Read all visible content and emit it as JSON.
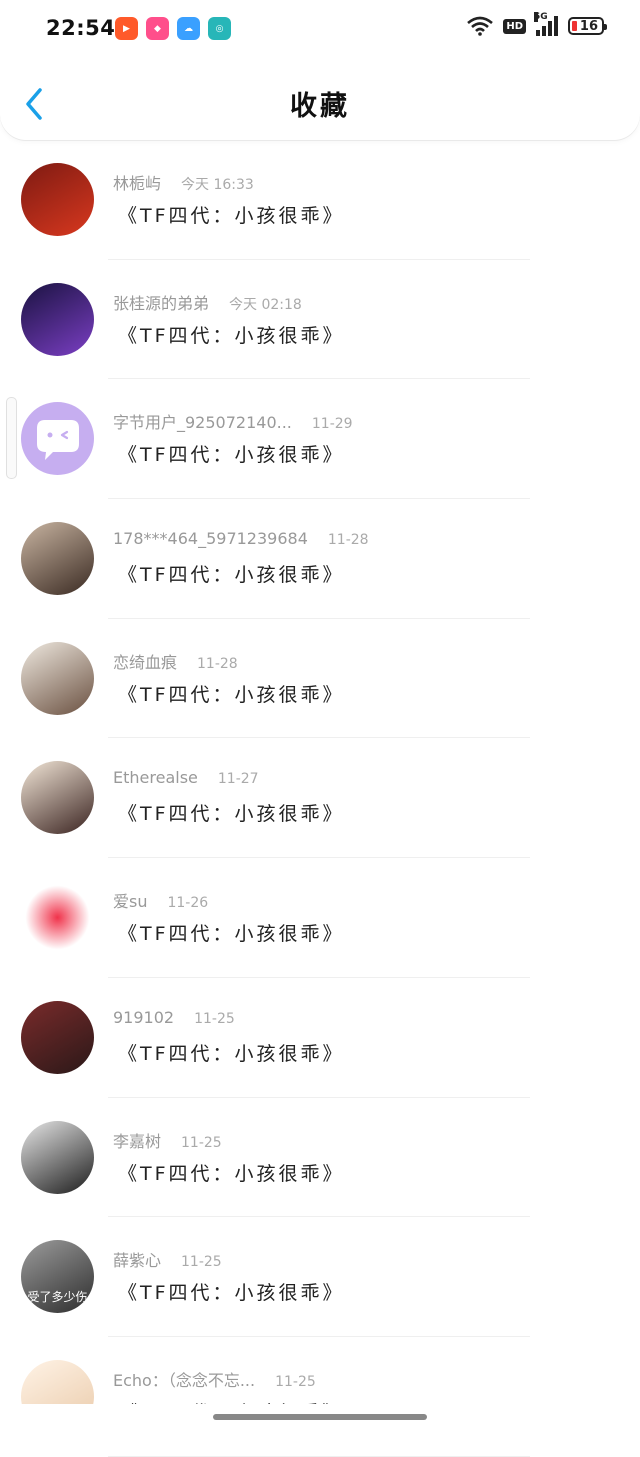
{
  "status_bar": {
    "time": "22:54",
    "hd": "HD",
    "network": "5G",
    "battery": "16",
    "app_icons": [
      "video-app-icon",
      "shop-app-icon",
      "weather-app-icon",
      "network-app-icon"
    ]
  },
  "nav": {
    "title": "收藏"
  },
  "items": [
    {
      "name": "林栀屿",
      "time": "今天 16:33",
      "content": "《TF四代：小孩很乖》",
      "avatar_colors": [
        "#7d1a12",
        "#d8381f"
      ]
    },
    {
      "name": "张桂源的弟弟",
      "time": "今天 02:18",
      "content": "《TF四代：小孩很乖》",
      "avatar_colors": [
        "#1a1240",
        "#7b3fc4"
      ]
    },
    {
      "name": "字节用户_925072140...",
      "time": "11-29",
      "content": "《TF四代：小孩很乖》",
      "avatar_colors": [
        "#d7c4f6",
        "#c6aef0"
      ]
    },
    {
      "name": "178***464_5971239684",
      "time": "11-28",
      "content": "《TF四代：小孩很乖》",
      "avatar_colors": [
        "#c9b5a2",
        "#3a2a22"
      ]
    },
    {
      "name": "恋绮血痕",
      "time": "11-28",
      "content": "《TF四代：小孩很乖》",
      "avatar_colors": [
        "#efe9e0",
        "#6a5040"
      ]
    },
    {
      "name": "Etherealse",
      "time": "11-27",
      "content": "《TF四代：小孩很乖》",
      "avatar_colors": [
        "#f3e7d8",
        "#3a2320"
      ]
    },
    {
      "name": "爱su",
      "time": "11-26",
      "content": "《TF四代：小孩很乖》",
      "avatar_colors": [
        "#ffffff",
        "#f0334b"
      ]
    },
    {
      "name": "919102",
      "time": "11-25",
      "content": "《TF四代：小孩很乖》",
      "avatar_colors": [
        "#7a2b2b",
        "#2a1818"
      ]
    },
    {
      "name": "李嘉树",
      "time": "11-25",
      "content": "《TF四代：小孩很乖》",
      "avatar_colors": [
        "#e7e7e7",
        "#1c1c1c"
      ]
    },
    {
      "name": "薛紫心",
      "time": "11-25",
      "content": "《TF四代：小孩很乖》",
      "avatar_colors": [
        "#9c9c9c",
        "#2e2e2e"
      ],
      "avatar_caption": "受了多少伤"
    },
    {
      "name": "Echo：（念念不忘...",
      "time": "11-25",
      "content": "《TF四代：小孩很乖》",
      "avatar_colors": [
        "#fff3e6",
        "#e9c9a8"
      ]
    }
  ]
}
